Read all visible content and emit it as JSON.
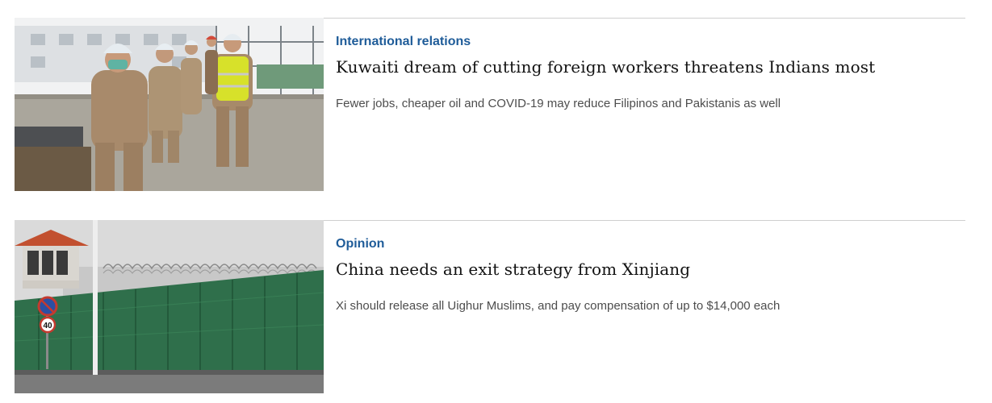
{
  "articles": [
    {
      "section": "International relations",
      "headline": "Kuwaiti dream of cutting foreign workers threatens Indians most",
      "rubric": "Fewer jobs, cheaper oil and COVID-19 may reduce Filipinos and Pakistanis as well",
      "image": {
        "subject": "construction-workers-photo",
        "colors": {
          "sky": "#eef0f2",
          "ground": "#a9a59b",
          "uniform": "#a8896a",
          "vest": "#d8e22a",
          "helmet": "#e8eef2"
        }
      }
    },
    {
      "section": "Opinion",
      "headline": "China needs an exit strategy from Xinjiang",
      "rubric": "Xi should release all Uighur Muslims, and pay compensation of up to $14,000 each",
      "image": {
        "subject": "fenced-compound-photo",
        "sign_text": "40",
        "colors": {
          "sky": "#dcdcdc",
          "fence": "#2e6e4a",
          "roof": "#c2502f",
          "road": "#7a7a7a"
        }
      }
    }
  ],
  "colors": {
    "section": "#1f5c99",
    "headline": "#121212",
    "rubric": "#4d4d4d",
    "rule": "#cfcfcf"
  }
}
